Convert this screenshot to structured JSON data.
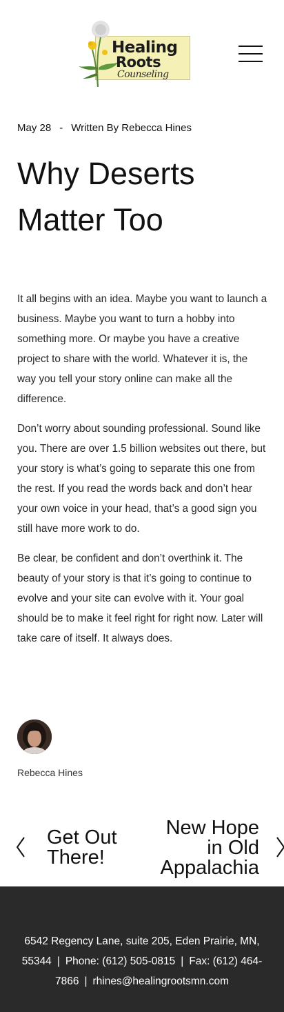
{
  "header": {
    "logo": {
      "line1": "Healing",
      "line2": "Roots",
      "line3": "Counseling"
    },
    "menu_icon": "hamburger-menu-icon"
  },
  "post": {
    "date": "May 28",
    "separator": "-",
    "byline": "Written By Rebecca Hines",
    "title_line1": "Why Deserts",
    "title_line2": "Matter Too",
    "paragraphs": [
      "It all begins with an idea. Maybe you want to launch a business. Maybe you want to turn a hobby into something more. Or maybe you have a creative project to share with the world. Whatever it is, the way you tell your story online can make all the difference.",
      "Don’t worry about sounding professional. Sound like you. There are over 1.5 billion websites out there, but your story is what’s going to separate this one from the rest. If you read the words back and don’t hear your own voice in your head, that’s a good sign you still have more work to do.",
      "Be clear, be confident and don’t overthink it. The beauty of your story is that it’s going to continue to evolve and your site can evolve with it. Your goal should be to make it feel right for right now. Later will take care of itself. It always does."
    ],
    "author": "Rebecca Hines"
  },
  "post_nav": {
    "prev_title_line1": "Get Out",
    "prev_title_line2": "There!",
    "next_title_line1": "New Hope",
    "next_title_line2": "in Old",
    "next_title_line3": "Appalachia"
  },
  "footer": {
    "address": "6542 Regency Lane, suite 205, Eden Prairie, MN, 55344",
    "pipe": "|",
    "phone": "Phone: (612) 505-0815",
    "fax": "Fax: (612) 464-7866",
    "email": "rhines@healingrootsmn.com"
  },
  "colors": {
    "footer_bg": "#2a2a2a",
    "logo_bg": "#f4f0b6",
    "text": "#111111"
  }
}
